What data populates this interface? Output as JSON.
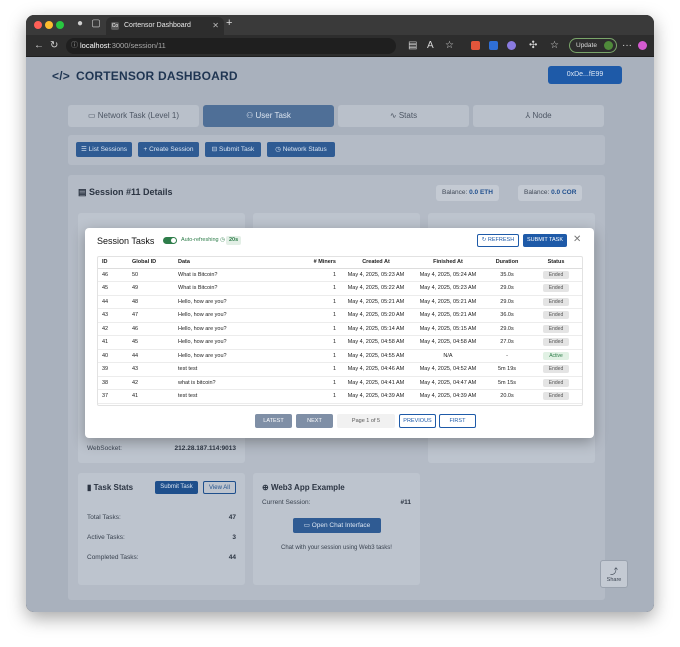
{
  "browser": {
    "tab_title": "Cortensor Dashboard",
    "tab_favicon": "Co",
    "url_host": "localhost",
    "url_path": ":3000/session/11",
    "update_label": "Update"
  },
  "header": {
    "brand": "CORTENSOR DASHBOARD",
    "wallet": "0xDe...fE99"
  },
  "nav_tabs": [
    {
      "label": "Network Task (Level 1)",
      "icon": "monitor-icon"
    },
    {
      "label": "User Task",
      "icon": "user-icon"
    },
    {
      "label": "Stats",
      "icon": "activity-icon"
    },
    {
      "label": "Node",
      "icon": "network-icon"
    }
  ],
  "actions": [
    {
      "label": "List Sessions"
    },
    {
      "label": "Create Session"
    },
    {
      "label": "Submit Task"
    },
    {
      "label": "Network Status"
    }
  ],
  "session": {
    "title": "Session #11 Details",
    "balance_eth_label": "Balance:",
    "balance_eth": "0.0 ETH",
    "balance_cor_label": "Balance:",
    "balance_cor": "0.0 COR",
    "websocket_label": "WebSocket:",
    "websocket_value": "212.28.187.114:9013"
  },
  "task_stats": {
    "title": "Task Stats",
    "submit_label": "Submit Task",
    "view_all_label": "View All",
    "rows": [
      {
        "label": "Total Tasks:",
        "value": "47"
      },
      {
        "label": "Active Tasks:",
        "value": "3"
      },
      {
        "label": "Completed Tasks:",
        "value": "44"
      }
    ]
  },
  "web3": {
    "title": "Web3 App Example",
    "current_label": "Current Session:",
    "current_value": "#11",
    "button_label": "Open Chat Interface",
    "subtitle": "Chat with your session using Web3 tasks!"
  },
  "share_label": "Share",
  "modal": {
    "title": "Session Tasks",
    "auto_label": "Auto-refreshing",
    "timer": "20s",
    "refresh_label": "REFRESH",
    "submit_label": "SUBMIT TASK",
    "columns": [
      "ID",
      "Global ID",
      "Data",
      "# Miners",
      "Created At",
      "Finished At",
      "Duration",
      "Status"
    ],
    "rows": [
      {
        "id": "46",
        "gid": "50",
        "data": "What is Bitcoin?",
        "miners": "1",
        "created": "May 4, 2025, 05:23 AM",
        "finished": "May 4, 2025, 05:24 AM",
        "duration": "35.0s",
        "status": "Ended"
      },
      {
        "id": "45",
        "gid": "49",
        "data": "What is Bitcoin?",
        "miners": "1",
        "created": "May 4, 2025, 05:22 AM",
        "finished": "May 4, 2025, 05:23 AM",
        "duration": "29.0s",
        "status": "Ended"
      },
      {
        "id": "44",
        "gid": "48",
        "data": "Hello, how are you?",
        "miners": "1",
        "created": "May 4, 2025, 05:21 AM",
        "finished": "May 4, 2025, 05:21 AM",
        "duration": "29.0s",
        "status": "Ended"
      },
      {
        "id": "43",
        "gid": "47",
        "data": "Hello, how are you?",
        "miners": "1",
        "created": "May 4, 2025, 05:20 AM",
        "finished": "May 4, 2025, 05:21 AM",
        "duration": "36.0s",
        "status": "Ended"
      },
      {
        "id": "42",
        "gid": "46",
        "data": "Hello, how are you?",
        "miners": "1",
        "created": "May 4, 2025, 05:14 AM",
        "finished": "May 4, 2025, 05:15 AM",
        "duration": "29.0s",
        "status": "Ended"
      },
      {
        "id": "41",
        "gid": "45",
        "data": "Hello, how are you?",
        "miners": "1",
        "created": "May 4, 2025, 04:58 AM",
        "finished": "May 4, 2025, 04:58 AM",
        "duration": "27.0s",
        "status": "Ended"
      },
      {
        "id": "40",
        "gid": "44",
        "data": "Hello, how are you?",
        "miners": "1",
        "created": "May 4, 2025, 04:55 AM",
        "finished": "N/A",
        "duration": "-",
        "status": "Active"
      },
      {
        "id": "39",
        "gid": "43",
        "data": "test test",
        "miners": "1",
        "created": "May 4, 2025, 04:46 AM",
        "finished": "May 4, 2025, 04:52 AM",
        "duration": "5m 19s",
        "status": "Ended"
      },
      {
        "id": "38",
        "gid": "42",
        "data": "what is bitcoin?",
        "miners": "1",
        "created": "May 4, 2025, 04:41 AM",
        "finished": "May 4, 2025, 04:47 AM",
        "duration": "5m 15s",
        "status": "Ended"
      },
      {
        "id": "37",
        "gid": "41",
        "data": "test test",
        "miners": "1",
        "created": "May 4, 2025, 04:39 AM",
        "finished": "May 4, 2025, 04:39 AM",
        "duration": "20.0s",
        "status": "Ended"
      }
    ],
    "pager": {
      "latest": "LATEST",
      "next": "NEXT",
      "page_info": "Page 1 of 5",
      "previous": "PREVIOUS",
      "first": "FIRST"
    }
  }
}
